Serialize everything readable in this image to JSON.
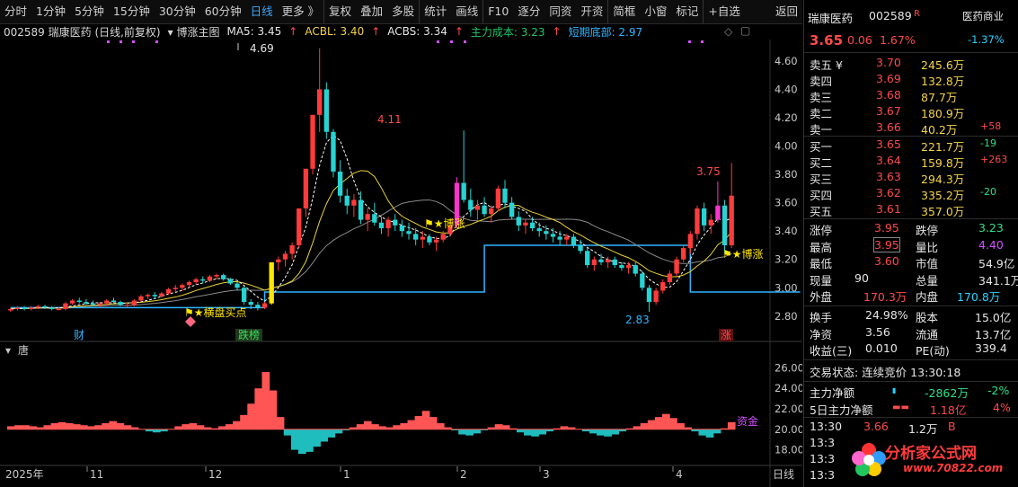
{
  "toolbar": {
    "items": [
      "分时",
      "1分钟",
      "5分钟",
      "15分钟",
      "30分钟",
      "60分钟",
      "日线",
      "更多 》",
      "复权",
      "叠加",
      "多股",
      "统计",
      "画线",
      "F10",
      "逐分",
      "同资",
      "开资",
      "简框",
      "小窗",
      "标记",
      "+自选",
      "返回"
    ],
    "active": "日线"
  },
  "legend": {
    "stock": "002589 瑞康医药 (日线,前复权)",
    "formula": "博涨主图",
    "ma5_label": "MA5: 3.45",
    "acbl_label": "ACBL: 3.40",
    "acbs_label": "ACBS: 3.34",
    "cost_label": "主力成本: 3.23",
    "bottom_label": "短期底部: 2.97"
  },
  "price_axis": [
    "4.60",
    "4.40",
    "4.20",
    "4.00",
    "3.80",
    "3.60",
    "3.40",
    "3.20",
    "3.00",
    "2.80"
  ],
  "osc_axis": [
    "26.00",
    "24.00",
    "22.00",
    "20.00",
    "18.00"
  ],
  "date_axis": [
    "2025年",
    "11",
    "12",
    "1",
    "2",
    "3",
    "4",
    "日线"
  ],
  "chart_labels": {
    "high1": "4.69",
    "high2": "4.11",
    "high3": "3.75",
    "low": "2.83",
    "signal_buy": "横盘买点",
    "signal_bozhang1": "博涨",
    "signal_bozhang2": "博涨",
    "tag_cai": "财",
    "tag_dieban": "跌榜",
    "tag_zhang": "涨",
    "osc_title": "唐",
    "osc_tag": "资金"
  },
  "chart_data": {
    "type": "candlestick",
    "title": "002589 瑞康医药 (日线,前复权)",
    "ylim": [
      2.75,
      4.72
    ],
    "x": [
      "2025-10",
      "2025-11",
      "2025-12",
      "2026-01",
      "2026-02",
      "2026-03",
      "2026-04"
    ],
    "ohlc": [
      [
        2.84,
        2.86,
        2.83,
        2.85
      ],
      [
        2.85,
        2.87,
        2.84,
        2.86
      ],
      [
        2.86,
        2.87,
        2.84,
        2.85
      ],
      [
        2.85,
        2.87,
        2.84,
        2.86
      ],
      [
        2.86,
        2.88,
        2.85,
        2.87
      ],
      [
        2.87,
        2.88,
        2.85,
        2.86
      ],
      [
        2.86,
        2.87,
        2.84,
        2.85
      ],
      [
        2.85,
        2.86,
        2.84,
        2.85
      ],
      [
        2.85,
        2.9,
        2.84,
        2.89
      ],
      [
        2.89,
        2.92,
        2.88,
        2.91
      ],
      [
        2.91,
        2.93,
        2.89,
        2.9
      ],
      [
        2.9,
        2.92,
        2.88,
        2.89
      ],
      [
        2.89,
        2.91,
        2.87,
        2.88
      ],
      [
        2.88,
        2.9,
        2.86,
        2.89
      ],
      [
        2.89,
        2.92,
        2.87,
        2.91
      ],
      [
        2.91,
        2.93,
        2.89,
        2.9
      ],
      [
        2.9,
        2.91,
        2.87,
        2.88
      ],
      [
        2.88,
        2.9,
        2.86,
        2.88
      ],
      [
        2.88,
        2.92,
        2.87,
        2.91
      ],
      [
        2.91,
        2.95,
        2.9,
        2.94
      ],
      [
        2.94,
        2.96,
        2.92,
        2.95
      ],
      [
        2.95,
        2.97,
        2.92,
        2.94
      ],
      [
        2.94,
        2.97,
        2.93,
        2.96
      ],
      [
        2.96,
        3.0,
        2.95,
        2.99
      ],
      [
        2.99,
        3.02,
        2.97,
        3.0
      ],
      [
        3.0,
        3.03,
        2.98,
        3.02
      ],
      [
        3.02,
        3.05,
        3.0,
        3.04
      ],
      [
        3.04,
        3.07,
        3.02,
        3.06
      ],
      [
        3.06,
        3.08,
        3.03,
        3.05
      ],
      [
        3.05,
        3.09,
        3.04,
        3.08
      ],
      [
        3.08,
        3.1,
        3.06,
        3.09
      ],
      [
        3.09,
        3.1,
        3.05,
        3.06
      ],
      [
        3.06,
        3.07,
        3.02,
        3.03
      ],
      [
        3.03,
        3.04,
        2.98,
        3.0
      ],
      [
        3.0,
        3.01,
        2.88,
        2.9
      ],
      [
        2.9,
        2.92,
        2.85,
        2.88
      ],
      [
        2.88,
        2.9,
        2.84,
        2.86
      ],
      [
        2.86,
        2.9,
        2.85,
        2.89
      ],
      [
        2.89,
        3.18,
        2.88,
        3.18
      ],
      [
        3.18,
        3.22,
        3.12,
        3.2
      ],
      [
        3.2,
        3.26,
        3.15,
        3.24
      ],
      [
        3.24,
        3.32,
        3.2,
        3.3
      ],
      [
        3.3,
        3.56,
        3.28,
        3.56
      ],
      [
        3.56,
        3.84,
        3.5,
        3.84
      ],
      [
        3.84,
        4.22,
        3.8,
        4.22
      ],
      [
        4.22,
        4.69,
        4.1,
        4.4
      ],
      [
        4.4,
        4.45,
        4.05,
        4.1
      ],
      [
        4.1,
        4.12,
        3.78,
        3.82
      ],
      [
        3.82,
        3.9,
        3.6,
        3.65
      ],
      [
        3.65,
        3.7,
        3.52,
        3.58
      ],
      [
        3.58,
        3.66,
        3.5,
        3.62
      ],
      [
        3.62,
        3.68,
        3.45,
        3.48
      ],
      [
        3.48,
        3.56,
        3.4,
        3.52
      ],
      [
        3.52,
        3.6,
        3.44,
        3.46
      ],
      [
        3.46,
        3.5,
        3.38,
        3.42
      ],
      [
        3.42,
        3.5,
        3.36,
        3.48
      ],
      [
        3.48,
        3.52,
        3.4,
        3.44
      ],
      [
        3.44,
        3.48,
        3.36,
        3.4
      ],
      [
        3.4,
        3.46,
        3.34,
        3.38
      ],
      [
        3.38,
        3.42,
        3.3,
        3.34
      ],
      [
        3.34,
        3.4,
        3.28,
        3.36
      ],
      [
        3.36,
        3.38,
        3.3,
        3.32
      ],
      [
        3.32,
        3.36,
        3.26,
        3.34
      ],
      [
        3.34,
        3.4,
        3.32,
        3.38
      ],
      [
        3.38,
        3.46,
        3.36,
        3.44
      ],
      [
        3.44,
        3.78,
        3.42,
        3.74
      ],
      [
        3.74,
        4.11,
        3.6,
        3.62
      ],
      [
        3.62,
        3.7,
        3.5,
        3.55
      ],
      [
        3.55,
        3.62,
        3.48,
        3.58
      ],
      [
        3.58,
        3.64,
        3.5,
        3.52
      ],
      [
        3.52,
        3.58,
        3.46,
        3.56
      ],
      [
        3.56,
        3.72,
        3.54,
        3.7
      ],
      [
        3.7,
        3.76,
        3.56,
        3.6
      ],
      [
        3.6,
        3.64,
        3.48,
        3.5
      ],
      [
        3.5,
        3.54,
        3.4,
        3.44
      ],
      [
        3.44,
        3.48,
        3.38,
        3.46
      ],
      [
        3.46,
        3.5,
        3.4,
        3.42
      ],
      [
        3.42,
        3.46,
        3.36,
        3.4
      ],
      [
        3.4,
        3.44,
        3.34,
        3.38
      ],
      [
        3.38,
        3.42,
        3.32,
        3.36
      ],
      [
        3.36,
        3.4,
        3.3,
        3.34
      ],
      [
        3.34,
        3.38,
        3.3,
        3.36
      ],
      [
        3.36,
        3.38,
        3.28,
        3.3
      ],
      [
        3.3,
        3.34,
        3.24,
        3.26
      ],
      [
        3.26,
        3.28,
        3.14,
        3.16
      ],
      [
        3.16,
        3.22,
        3.12,
        3.2
      ],
      [
        3.2,
        3.24,
        3.16,
        3.18
      ],
      [
        3.18,
        3.22,
        3.14,
        3.2
      ],
      [
        3.2,
        3.22,
        3.14,
        3.16
      ],
      [
        3.16,
        3.18,
        3.12,
        3.14
      ],
      [
        3.14,
        3.18,
        3.1,
        3.16
      ],
      [
        3.16,
        3.18,
        3.08,
        3.1
      ],
      [
        3.1,
        3.12,
        2.98,
        3.0
      ],
      [
        3.0,
        3.02,
        2.83,
        2.9
      ],
      [
        2.9,
        3.0,
        2.88,
        2.98
      ],
      [
        2.98,
        3.06,
        2.96,
        3.04
      ],
      [
        3.04,
        3.12,
        3.02,
        3.1
      ],
      [
        3.1,
        3.22,
        3.08,
        3.2
      ],
      [
        3.2,
        3.3,
        3.18,
        3.28
      ],
      [
        3.28,
        3.4,
        3.24,
        3.38
      ],
      [
        3.38,
        3.58,
        3.34,
        3.56
      ],
      [
        3.56,
        3.6,
        3.4,
        3.44
      ],
      [
        3.44,
        3.52,
        3.38,
        3.48
      ],
      [
        3.48,
        3.75,
        3.46,
        3.58
      ],
      [
        3.58,
        3.62,
        3.24,
        3.3
      ],
      [
        3.3,
        3.88,
        3.28,
        3.65
      ]
    ],
    "series": [
      {
        "name": "MA5",
        "value": 3.45
      },
      {
        "name": "ACBL",
        "value": 3.4
      },
      {
        "name": "ACBS",
        "value": 3.34
      },
      {
        "name": "主力成本",
        "value": 3.23
      },
      {
        "name": "短期底部",
        "value": 2.97
      }
    ],
    "bottom_line_steps": [
      [
        0,
        2.86
      ],
      [
        37,
        2.86
      ],
      [
        37,
        2.97
      ],
      [
        69,
        2.97
      ],
      [
        69,
        3.3
      ],
      [
        99,
        3.3
      ],
      [
        99,
        2.97
      ],
      [
        115,
        2.97
      ]
    ],
    "oscillator": {
      "ylim": [
        17,
        27
      ],
      "baseline": 20,
      "values": [
        20.3,
        20.4,
        20.4,
        20.3,
        20.2,
        20.4,
        20.6,
        20.7,
        20.6,
        20.5,
        20.4,
        20.3,
        20.4,
        20.6,
        20.8,
        20.6,
        20.4,
        20.2,
        20.0,
        19.8,
        19.7,
        19.8,
        20.0,
        20.3,
        20.5,
        20.6,
        20.4,
        20.2,
        20.1,
        20.3,
        20.5,
        20.8,
        21.4,
        22.5,
        24.0,
        25.6,
        23.8,
        21.2,
        19.4,
        18.0,
        17.6,
        17.8,
        18.3,
        18.8,
        19.2,
        19.6,
        19.9,
        20.2,
        20.5,
        20.8,
        20.5,
        20.3,
        20.2,
        20.4,
        20.6,
        20.9,
        21.3,
        21.8,
        21.2,
        20.6,
        20.2,
        19.9,
        19.5,
        19.4,
        19.6,
        19.9,
        20.2,
        20.5,
        20.4,
        20.1,
        19.7,
        19.4,
        19.3,
        19.5,
        19.8,
        20.1,
        20.3,
        20.2,
        20.0,
        19.8,
        19.6,
        19.4,
        19.3,
        19.5,
        19.8,
        20.1,
        20.3,
        20.6,
        20.9,
        21.2,
        21.5,
        21.1,
        20.6,
        20.2,
        19.8,
        19.4,
        19.2,
        19.6,
        20.1,
        20.7
      ],
      "tag": "资金"
    }
  },
  "panel": {
    "name": "瑞康医药",
    "code": "002589",
    "r_badge": "R",
    "industry": "医药商业",
    "industry_pct": "-1.37%",
    "price": "3.65",
    "change": "0.06",
    "pct": "1.67%",
    "sells": [
      {
        "label": "卖五 ¥",
        "price": "3.70",
        "vol": "245.6万",
        "delta": ""
      },
      {
        "label": "卖四",
        "price": "3.69",
        "vol": "132.8万",
        "delta": ""
      },
      {
        "label": "卖三",
        "price": "3.68",
        "vol": "87.7万",
        "delta": ""
      },
      {
        "label": "卖二",
        "price": "3.67",
        "vol": "180.9万",
        "delta": ""
      },
      {
        "label": "卖一",
        "price": "3.66",
        "vol": "40.2万",
        "delta": "+58"
      }
    ],
    "buys": [
      {
        "label": "买一",
        "price": "3.65",
        "vol": "221.7万",
        "delta": "-19"
      },
      {
        "label": "买二",
        "price": "3.64",
        "vol": "159.8万",
        "delta": "+263"
      },
      {
        "label": "买三",
        "price": "3.63",
        "vol": "294.3万",
        "delta": ""
      },
      {
        "label": "买四",
        "price": "3.62",
        "vol": "335.2万",
        "delta": "-20"
      },
      {
        "label": "买五",
        "price": "3.61",
        "vol": "357.0万",
        "delta": ""
      }
    ],
    "stats": [
      {
        "l1": "涨停",
        "v1": "3.95",
        "l2": "跌停",
        "v2": "3.23"
      },
      {
        "l1": "最高",
        "v1": "3.95",
        "l2": "量比",
        "v2": "4.40"
      },
      {
        "l1": "最低",
        "v1": "3.60",
        "l2": "市值",
        "v2": "54.9亿"
      },
      {
        "l1": "现量",
        "v1": "90",
        "l2": "总量",
        "v2": "341.1万"
      },
      {
        "l1": "外盘",
        "v1": "170.3万",
        "l2": "内盘",
        "v2": "170.8万"
      }
    ],
    "stats2": [
      {
        "l1": "换手",
        "v1": "24.98%",
        "l2": "股本",
        "v2": "15.0亿"
      },
      {
        "l1": "净资",
        "v1": "3.56",
        "l2": "流通",
        "v2": "13.7亿"
      },
      {
        "l1": "收益(三)",
        "v1": "0.010",
        "l2": "PE(动)",
        "v2": "339.4"
      }
    ],
    "trade_state": "交易状态: 连续竞价 13:30:18",
    "flow1": {
      "label": "主力净额",
      "value": "-2862万",
      "pct": "-2%"
    },
    "flow2": {
      "label": "5日主力净额",
      "value": "1.18亿",
      "pct": "4%"
    },
    "tick_row": {
      "time": "13:30",
      "price": "3.66",
      "vol": "1.2万",
      "flag": "B"
    },
    "tick_times": [
      "13:3",
      "13:3",
      "13:3"
    ],
    "watermark_logo": "分析家公式网",
    "watermark_url": "www.70822.com"
  }
}
